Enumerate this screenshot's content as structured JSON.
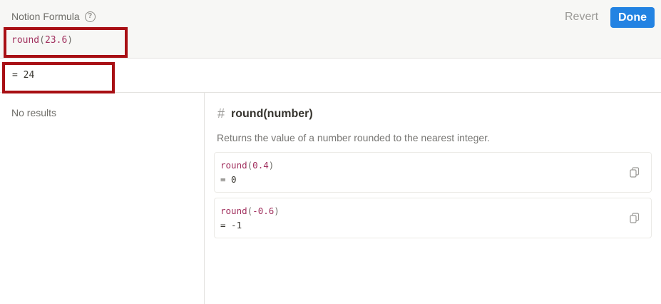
{
  "header": {
    "title": "Notion Formula",
    "help_icon": "?",
    "revert_label": "Revert",
    "done_label": "Done"
  },
  "formula": {
    "function": "round",
    "open_paren": "(",
    "argument": "23.6",
    "close_paren": ")"
  },
  "result": {
    "text": "= 24"
  },
  "search": {
    "no_results": "No results"
  },
  "doc": {
    "icon": "#",
    "title": "round(number)",
    "description": "Returns the value of a number rounded to the nearest integer.",
    "examples": [
      {
        "function": "round",
        "open_paren": "(",
        "argument": "0.4",
        "close_paren": ")",
        "result": "= 0"
      },
      {
        "function": "round",
        "open_paren": "(",
        "argument": "-0.6",
        "close_paren": ")",
        "result": "= -1"
      }
    ]
  },
  "colors": {
    "highlight_border": "#a80f14",
    "done_button": "#2383e2",
    "function_name": "#a1305e"
  }
}
